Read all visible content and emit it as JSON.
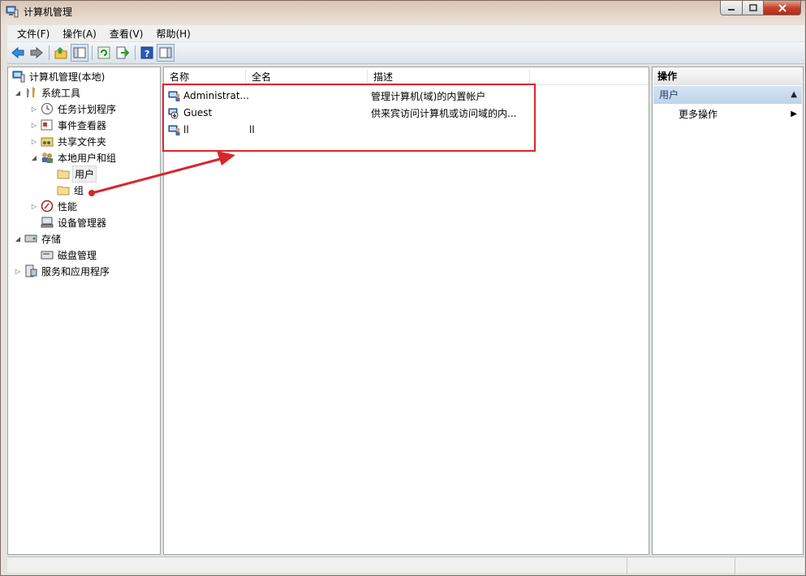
{
  "window": {
    "title": "计算机管理"
  },
  "menu": [
    "文件(F)",
    "操作(A)",
    "查看(V)",
    "帮助(H)"
  ],
  "toolbar": {
    "buttons": [
      "back-icon",
      "forward-icon",
      "up-icon",
      "show-hide-tree-icon",
      "refresh-icon",
      "export-list-icon",
      "help-icon",
      "show-hide-action-pane-icon"
    ]
  },
  "tree": {
    "root": "计算机管理(本地)",
    "system_tools": "系统工具",
    "task_scheduler": "任务计划程序",
    "event_viewer": "事件查看器",
    "shared_folders": "共享文件夹",
    "local_users": "本地用户和组",
    "users": "用户",
    "groups": "组",
    "performance": "性能",
    "device_manager": "设备管理器",
    "storage": "存储",
    "disk_management": "磁盘管理",
    "services": "服务和应用程序"
  },
  "list": {
    "columns": {
      "name": "名称",
      "fullname": "全名",
      "description": "描述"
    },
    "rows": [
      {
        "name": "Administrat...",
        "fullname": "",
        "description": "管理计算机(域)的内置帐户"
      },
      {
        "name": "Guest",
        "fullname": "",
        "description": "供来宾访问计算机或访问域的内..."
      },
      {
        "name": "ll",
        "fullname": "ll",
        "description": ""
      }
    ]
  },
  "actions": {
    "header": "操作",
    "section": "用户",
    "more": "更多操作"
  },
  "colors": {
    "highlight": "#e0242c",
    "arrow": "#d8262a"
  }
}
